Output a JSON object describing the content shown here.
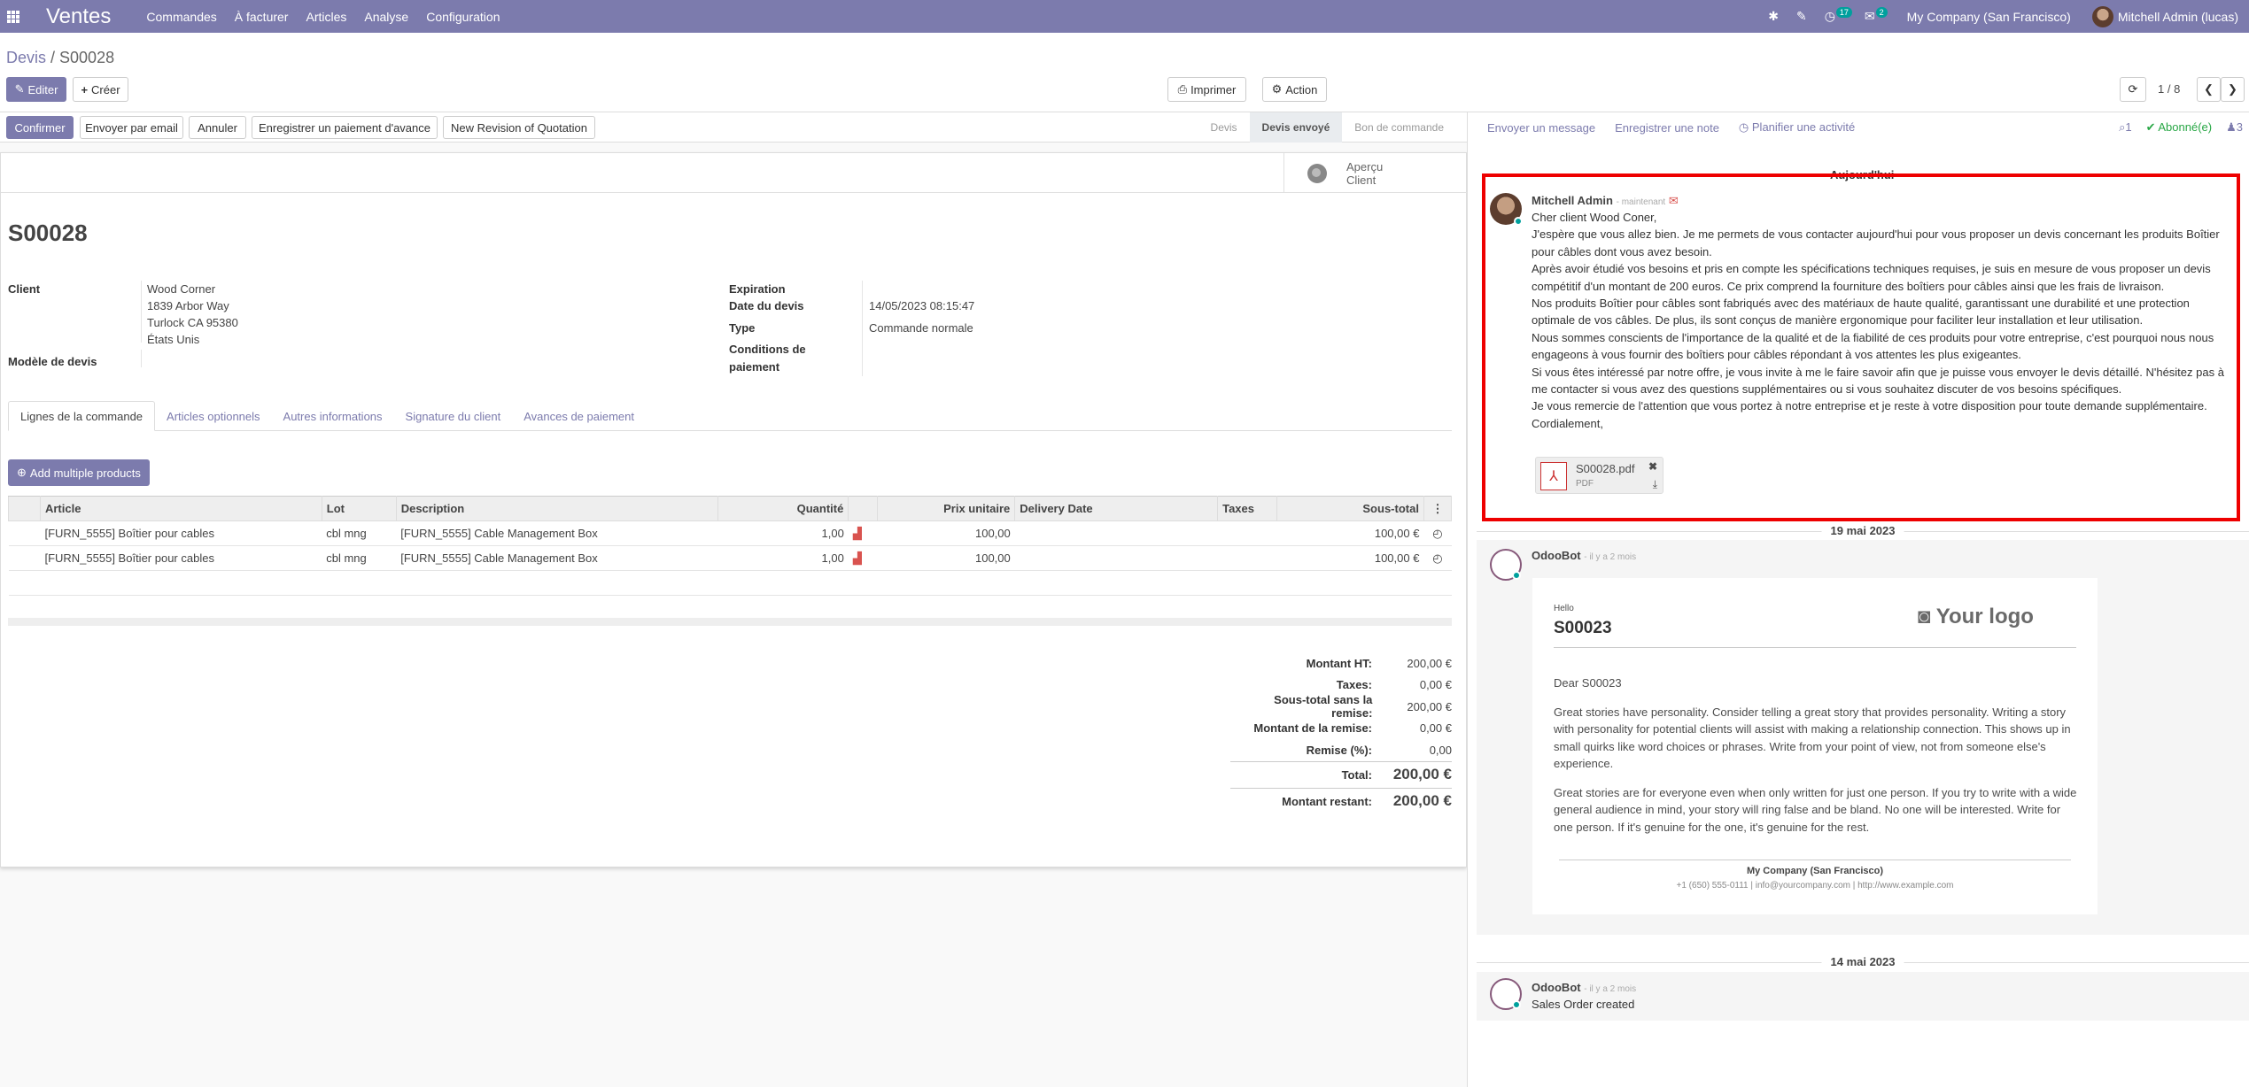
{
  "topnav": {
    "app_name": "Ventes",
    "menu": [
      "Commandes",
      "À facturer",
      "Articles",
      "Analyse",
      "Configuration"
    ],
    "activity_count": "17",
    "message_count": "2",
    "company": "My Company (San Francisco)",
    "user": "Mitchell Admin (lucas)"
  },
  "breadcrumb": {
    "parent": "Devis",
    "separator": " / ",
    "current": "S00028"
  },
  "cpanel": {
    "edit": "Editer",
    "create": "Créer",
    "print": "Imprimer",
    "action": "Action",
    "pager": "1 / 8"
  },
  "statusbar": {
    "buttons": [
      "Confirmer",
      "Envoyer par email",
      "Annuler",
      "Enregistrer un paiement d'avance",
      "New Revision of Quotation"
    ],
    "steps": [
      "Devis",
      "Devis envoyé",
      "Bon de commande"
    ],
    "active_step": "Devis envoyé"
  },
  "smart_button": {
    "line1": "Aperçu",
    "line2": "Client"
  },
  "form": {
    "name": "S00028",
    "client_label": "Client",
    "client_name": "Wood Corner",
    "client_address": [
      "1839 Arbor Way",
      "Turlock CA 95380",
      "États Unis"
    ],
    "template_label": "Modèle de devis",
    "expiration_label": "Expiration",
    "date_label": "Date du devis",
    "date_value": "14/05/2023 08:15:47",
    "type_label": "Type",
    "type_value": "Commande normale",
    "payment_terms_label_1": "Conditions de",
    "payment_terms_label_2": "paiement"
  },
  "tabs": [
    "Lignes de la commande",
    "Articles optionnels",
    "Autres informations",
    "Signature du client",
    "Avances de paiement"
  ],
  "add_multiple": "Add multiple products",
  "lines_table": {
    "headers": [
      "Article",
      "Lot",
      "Description",
      "Quantité",
      "Prix unitaire",
      "Delivery Date",
      "Taxes",
      "Sous-total"
    ],
    "rows": [
      [
        "[FURN_5555] Boîtier pour cables",
        "cbl mng",
        "[FURN_5555] Cable Management Box",
        "1,00",
        "100,00",
        "",
        "",
        "100,00 €"
      ],
      [
        "[FURN_5555] Boîtier pour cables",
        "cbl mng",
        "[FURN_5555] Cable Management Box",
        "1,00",
        "100,00",
        "",
        "",
        "100,00 €"
      ]
    ]
  },
  "totals": [
    {
      "label": "Montant HT:",
      "value": "200,00 €"
    },
    {
      "label": "Taxes:",
      "value": "0,00 €"
    },
    {
      "label": "Sous-total sans la remise:",
      "value": "200,00 €"
    },
    {
      "label": "Montant de la remise:",
      "value": "0,00 €"
    },
    {
      "label": "Remise (%):",
      "value": "0,00"
    }
  ],
  "total": {
    "label": "Total:",
    "value": "200,00 €"
  },
  "remaining": {
    "label": "Montant restant:",
    "value": "200,00 €"
  },
  "chatter": {
    "send_message": "Envoyer un message",
    "log_note": "Enregistrer une note",
    "schedule": "Planifier une activité",
    "attachments_count": "1",
    "followed": "Abonné(e)",
    "followers_count": "3",
    "today": "Aujourd'hui",
    "msg1": {
      "author": "Mitchell Admin",
      "when": "- maintenant",
      "lines": [
        "Cher client Wood Coner,",
        "J'espère que vous allez bien. Je me permets de vous contacter aujourd'hui pour vous proposer un devis concernant les produits Boîtier",
        "pour câbles dont vous avez besoin.",
        "Après avoir étudié vos besoins et pris en compte les spécifications techniques requises, je suis en mesure de vous proposer un devis",
        "compétitif d'un montant de 200 euros. Ce prix comprend la fourniture des boîtiers pour câbles ainsi que les frais de livraison.",
        "Nos produits Boîtier pour câbles sont fabriqués avec des matériaux de haute qualité, garantissant une durabilité et une protection",
        "optimale de vos câbles. De plus, ils sont conçus de manière ergonomique pour faciliter leur installation et leur utilisation.",
        "Nous sommes conscients de l'importance de la qualité et de la fiabilité de ces produits pour votre entreprise, c'est pourquoi nous nous",
        "engageons à vous fournir des boîtiers pour câbles répondant à vos attentes les plus exigeantes.",
        "Si vous êtes intéressé par notre offre, je vous invite à me le faire savoir afin que je puisse vous envoyer le devis détaillé. N'hésitez pas à",
        "me contacter si vous avez des questions supplémentaires ou si vous souhaitez discuter de vos besoins spécifiques.",
        "Je vous remercie de l'attention que vous portez à notre entreprise et je reste à votre disposition pour toute demande supplémentaire.",
        "Cordialement,"
      ],
      "attachment_name": "S00028.pdf",
      "attachment_type": "PDF"
    },
    "date2": "19 mai 2023",
    "msg2": {
      "author": "OdooBot",
      "when": "- il y a 2 mois",
      "hello": "Hello",
      "ref": "S00023",
      "logo": "Your logo",
      "dear": "Dear S00023",
      "p1": "Great stories have personality. Consider telling a great story that provides personality. Writing a story with personality for potential clients will assist with making a relationship connection. This shows up in small quirks like word choices or phrases. Write from your point of view, not from someone else's experience.",
      "p2": "Great stories are for everyone even when only written for just one person. If you try to write with a wide general audience in mind, your story will ring false and be bland. No one will be interested. Write for one person. If it's genuine for the one, it's genuine for the rest.",
      "company": "My Company (San Francisco)",
      "contact": "+1 (650) 555-0111 | info@yourcompany.com | http://www.example.com"
    },
    "date3": "14 mai 2023",
    "msg3": {
      "author": "OdooBot",
      "when": "- il y a 2 mois",
      "text": "Sales Order created"
    }
  },
  "colors": {
    "brand": "#7c7bad",
    "highlight": "#e00000",
    "online": "#00a09d"
  }
}
